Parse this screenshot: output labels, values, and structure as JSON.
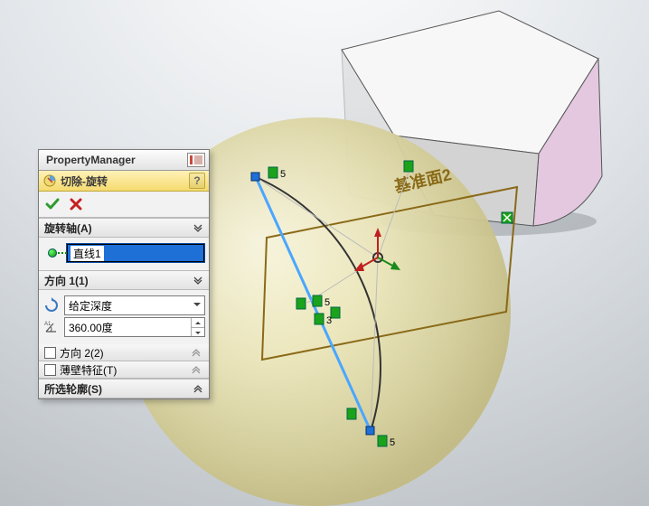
{
  "propertyManager": {
    "title": "PropertyManager",
    "feature": "切除-旋转",
    "helpLabel": "?",
    "sections": {
      "axis": {
        "title": "旋转轴(A)",
        "selected": "直线1"
      },
      "dir1": {
        "title": "方向 1(1)",
        "typeOptions": [
          "给定深度"
        ],
        "typeSelected": "给定深度",
        "angle": "360.00度"
      },
      "dir2": {
        "title": "方向 2(2)",
        "checked": false
      },
      "thin": {
        "title": "薄壁特征(T)",
        "checked": false
      },
      "contours": {
        "title": "所选轮廓(S)"
      }
    }
  },
  "scene": {
    "datumLabel": "基准面2",
    "pointLabels": [
      "5",
      "5",
      "5",
      "3",
      "5"
    ]
  },
  "icons": {
    "ok": "ok-icon",
    "cancel": "cancel-icon",
    "reverse": "reverse-icon",
    "angle": "angle-icon",
    "thumb": "thumbnail-icon",
    "featureCut": "cut-revolve-icon"
  },
  "colors": {
    "panel": "#f2f2f2",
    "featureBar": "#f5da6f",
    "selectHighlight": "#1e6fd6",
    "sphere": "#e6e0ae",
    "solidFace": "#e3c8e0",
    "datumEdge": "#8a6a18",
    "sketchBlue": "#4aa6ff",
    "handleGreen": "#1aa31a"
  }
}
